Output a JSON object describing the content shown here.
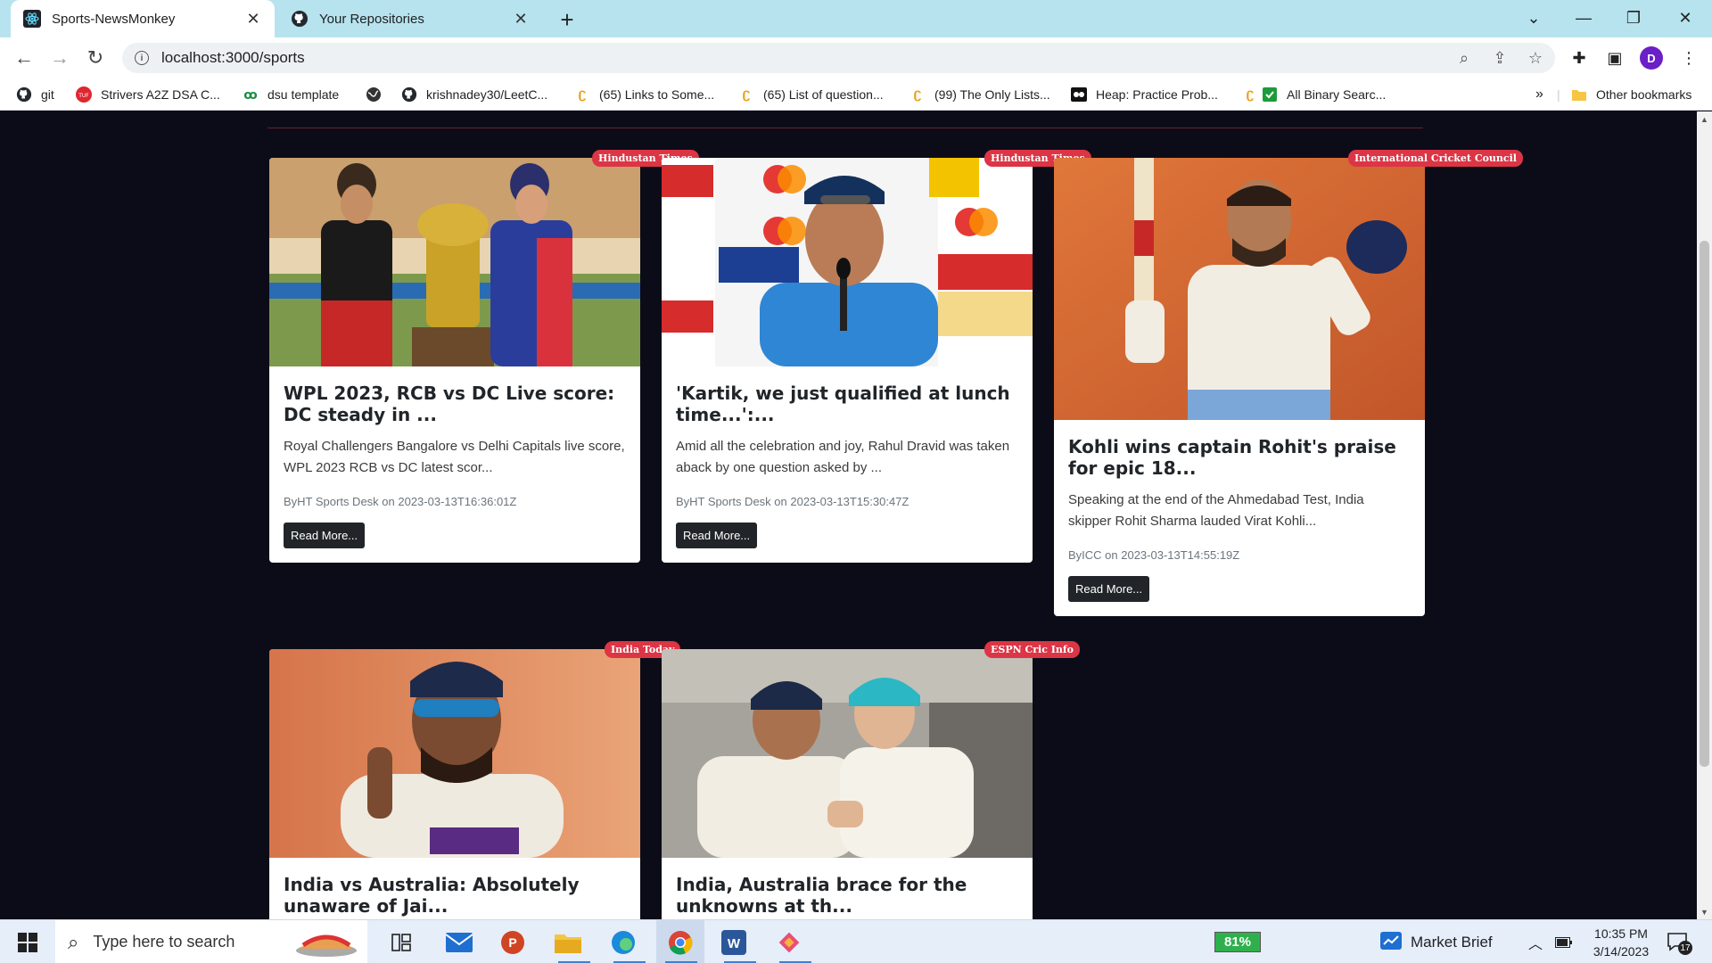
{
  "browser": {
    "tabs": [
      {
        "title": "Sports-NewsMonkey",
        "active": true
      },
      {
        "title": "Your Repositories",
        "active": false
      }
    ],
    "url": "localhost:3000/sports",
    "profile_initial": "D"
  },
  "bookmarks": [
    {
      "label": "git",
      "icon": "github-icon"
    },
    {
      "label": "Strivers A2Z DSA C...",
      "icon": "tuf-icon"
    },
    {
      "label": "dsu template",
      "icon": "dsu-icon"
    },
    {
      "label": "",
      "icon": "globe-icon"
    },
    {
      "label": "krishnadey30/LeetC...",
      "icon": "github-icon"
    },
    {
      "label": "(65) Links to Some...",
      "icon": "leetcode-icon"
    },
    {
      "label": "(65) List of question...",
      "icon": "leetcode-icon"
    },
    {
      "label": "(99) The Only Lists...",
      "icon": "leetcode-icon"
    },
    {
      "label": "Heap: Practice Prob...",
      "icon": "gfg-icon"
    },
    {
      "label": "All Binary Searc...",
      "icon": "checkbox-icon"
    }
  ],
  "bookmarks_more": "»",
  "other_bookmarks": "Other bookmarks",
  "articles": [
    {
      "source": "Hindustan Times",
      "title": "WPL 2023, RCB vs DC Live score: DC steady in ...",
      "description": "Royal Challengers Bangalore vs Delhi Capitals live score, WPL 2023 RCB vs DC latest scor...",
      "meta": "ByHT Sports Desk on 2023-03-13T16:36:01Z",
      "button": "Read More..."
    },
    {
      "source": "Hindustan Times",
      "title": "'Kartik, we just qualified at lunch time...':...",
      "description": "Amid all the celebration and joy, Rahul Dravid was taken aback by one question asked by ...",
      "meta": "ByHT Sports Desk on 2023-03-13T15:30:47Z",
      "button": "Read More..."
    },
    {
      "source": "International Cricket Council",
      "title": "Kohli wins captain Rohit's praise for epic 18...",
      "description": "Speaking at the end of the Ahmedabad Test, India skipper Rohit Sharma lauded Virat Kohli...",
      "meta": "ByICC on 2023-03-13T14:55:19Z",
      "button": "Read More..."
    },
    {
      "source": "India Today",
      "title": "India vs Australia: Absolutely unaware of Jai...",
      "description": "",
      "meta": "",
      "button": ""
    },
    {
      "source": "ESPN Cric Info",
      "title": "India, Australia brace for the unknowns at th...",
      "description": "",
      "meta": "",
      "button": ""
    }
  ],
  "taskbar": {
    "search_placeholder": "Type here to search",
    "battery": "81%",
    "widget": "Market Brief",
    "time": "10:35 PM",
    "date": "3/14/2023",
    "notifications": "17"
  }
}
